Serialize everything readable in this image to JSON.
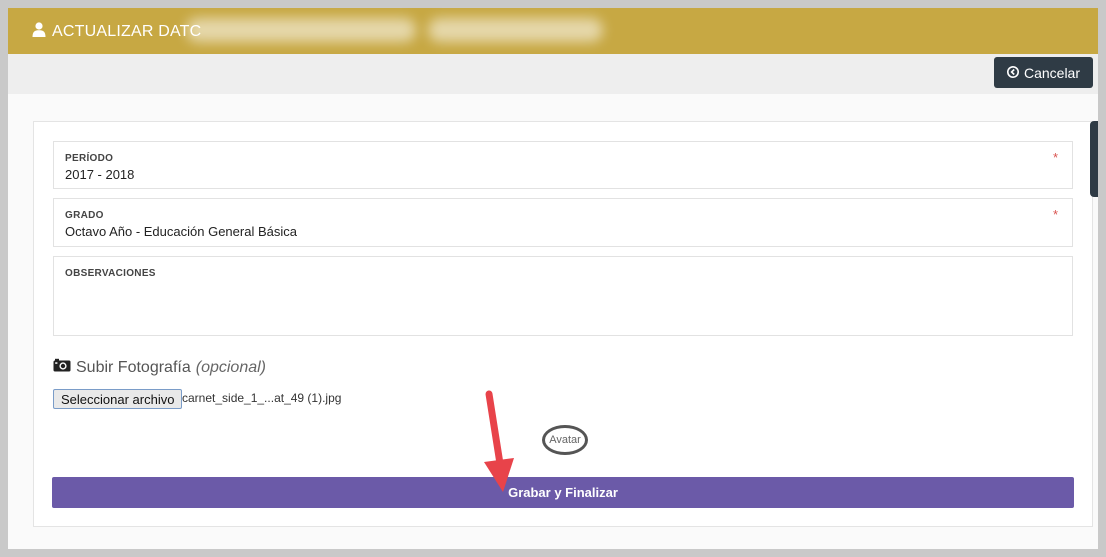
{
  "header": {
    "title": "ACTUALIZAR DATC",
    "icon": "user-icon",
    "color": "#c7a843"
  },
  "toolbar": {
    "cancel_label": "Cancelar",
    "cancel_icon": "circle-arrow-left-icon"
  },
  "form": {
    "periodo": {
      "label": "PERÍODO",
      "value": "2017 - 2018",
      "required_mark": "*"
    },
    "grado": {
      "label": "GRADO",
      "value": "Octavo Año - Educación General Básica",
      "required_mark": "*"
    },
    "observaciones": {
      "label": "OBSERVACIONES",
      "value": ""
    },
    "photo": {
      "title": "Subir Fotografía",
      "optional": "(opcional)",
      "icon": "camera-icon",
      "choose_label": "Seleccionar archivo",
      "file_name": "carnet_side_1_...at_49 (1).jpg",
      "avatar_alt": "Avatar"
    },
    "submit_label": "Grabar y Finalizar",
    "submit_color": "#6b5aa8"
  },
  "annotation": {
    "arrow_color": "#e8434a"
  }
}
